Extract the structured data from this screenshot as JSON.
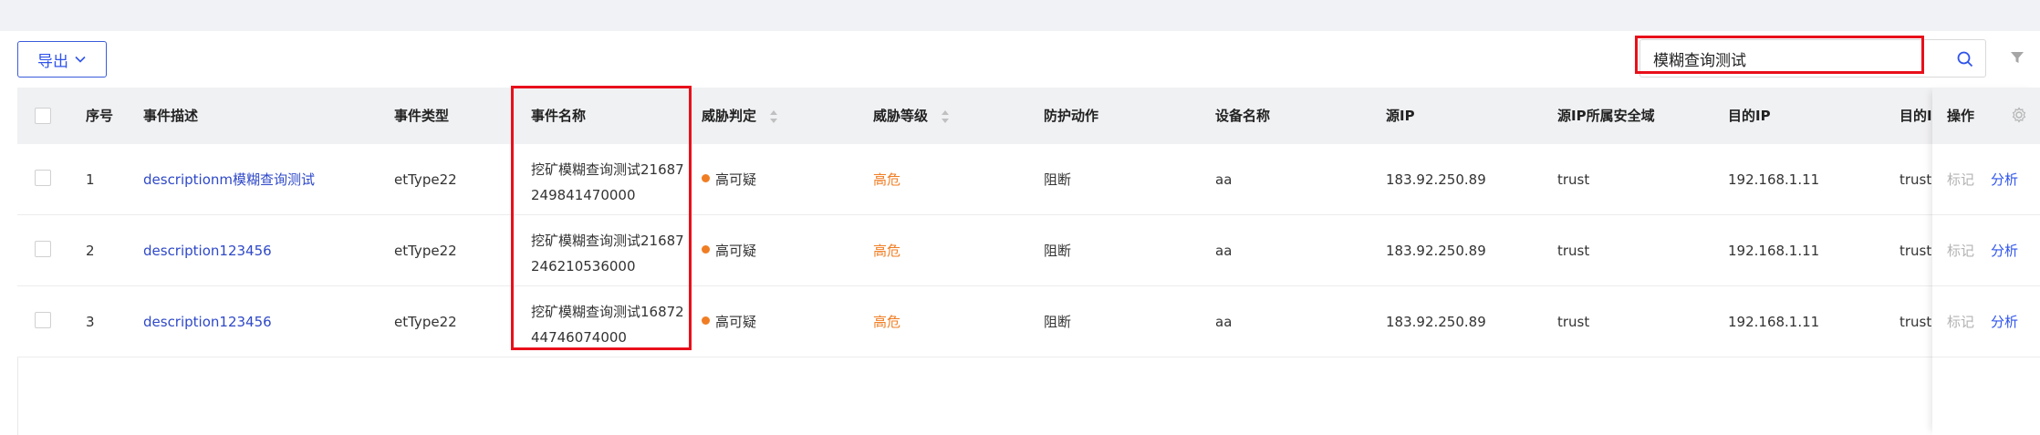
{
  "toolbar": {
    "export_label": "导出"
  },
  "search": {
    "value": "模糊查询测试"
  },
  "table": {
    "headers": {
      "seq": "序号",
      "desc": "事件描述",
      "type": "事件类型",
      "name": "事件名称",
      "threat_judge": "威胁判定",
      "threat_level": "威胁等级",
      "action": "防护动作",
      "device": "设备名称",
      "src_ip": "源IP",
      "src_zone": "源IP所属安全域",
      "dst_ip": "目的IP",
      "dst_zone": "目的IP",
      "ops": "操作"
    },
    "rows": [
      {
        "seq": "1",
        "desc": "descriptionm模糊查询测试",
        "type": "etType22",
        "name_l1": "挖矿模糊查询测试21687",
        "name_l2": "249841470000",
        "judge": "高可疑",
        "level": "高危",
        "action": "阻断",
        "device": "aa",
        "src_ip": "183.92.250.89",
        "src_zone": "trust",
        "dst_ip": "192.168.1.11",
        "dst_zone": "trust",
        "op_mark": "标记",
        "op_analyze": "分析"
      },
      {
        "seq": "2",
        "desc": "description123456",
        "type": "etType22",
        "name_l1": "挖矿模糊查询测试21687",
        "name_l2": "246210536000",
        "judge": "高可疑",
        "level": "高危",
        "action": "阻断",
        "device": "aa",
        "src_ip": "183.92.250.89",
        "src_zone": "trust",
        "dst_ip": "192.168.1.11",
        "dst_zone": "trust",
        "op_mark": "标记",
        "op_analyze": "分析"
      },
      {
        "seq": "3",
        "desc": "description123456",
        "type": "etType22",
        "name_l1": "挖矿模糊查询测试16872",
        "name_l2": "44746074000",
        "judge": "高可疑",
        "level": "高危",
        "action": "阻断",
        "device": "aa",
        "src_ip": "183.92.250.89",
        "src_zone": "trust",
        "dst_ip": "192.168.1.11",
        "dst_zone": "trust",
        "op_mark": "标记",
        "op_analyze": "分析"
      }
    ]
  },
  "colors": {
    "accent": "#2f54eb",
    "link": "#2f49c8",
    "danger": "#f07d23",
    "highlight": "#e8101a"
  },
  "icons": [
    "chevron-down-icon",
    "search-icon",
    "filter-icon",
    "sort-icon",
    "gear-icon"
  ]
}
